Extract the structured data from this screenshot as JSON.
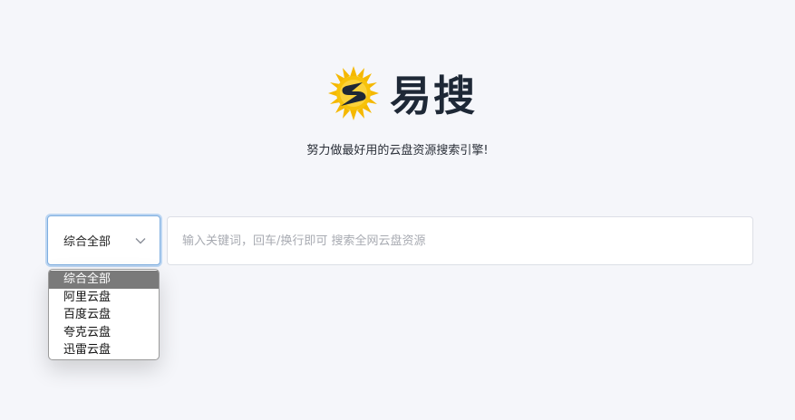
{
  "brand": {
    "name": "易搜",
    "logo_icon": "lightning-s-logo-icon",
    "logo_color": "#f5b800"
  },
  "slogan": "努力做最好用的云盘资源搜索引擎!",
  "search": {
    "category_selected": "综合全部",
    "category_options": [
      "综合全部",
      "阿里云盘",
      "百度云盘",
      "夸克云盘",
      "迅雷云盘"
    ],
    "placeholder": "输入关键词，回车/换行即可 搜索全网云盘资源",
    "value": ""
  },
  "colors": {
    "background": "#f5f6fa",
    "focus_ring": "#7eaee0",
    "selected_option": "#7a7a7a"
  }
}
